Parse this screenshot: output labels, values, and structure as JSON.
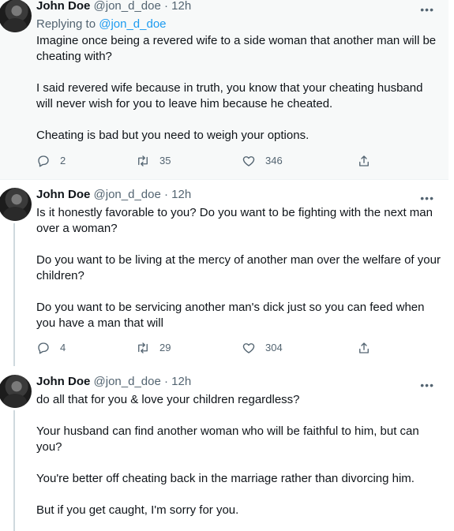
{
  "tweets": [
    {
      "name": "John Doe",
      "handle": "@jon_d_doe",
      "time": "· 12h",
      "reply_prefix": "Replying to ",
      "reply_handle": "@jon_d_doe",
      "paragraphs": [
        "Imagine once being a revered wife to a side woman that another man will be cheating with?",
        "I said revered wife because in truth, you know that your cheating husband will never wish for you to leave him because he cheated.",
        "Cheating is bad but you need to weigh your options."
      ],
      "replies": "2",
      "retweets": "35",
      "likes": "346"
    },
    {
      "name": "John Doe",
      "handle": "@jon_d_doe",
      "time": "· 12h",
      "paragraphs": [
        "Is it honestly favorable to you? Do you want to be fighting with the next man over a woman?",
        "Do you want to be living at the mercy of another man over the welfare of your children?",
        "Do you want to be servicing another man's dick just so you can feed when you have a man that will"
      ],
      "replies": "4",
      "retweets": "29",
      "likes": "304"
    },
    {
      "name": "John Doe",
      "handle": "@jon_d_doe",
      "time": "· 12h",
      "paragraphs": [
        "do all that for you & love your children regardless?",
        "Your husband can find another woman who will be faithful to him, but can you?",
        "You're better off cheating back in the marriage rather than divorcing him.",
        "But if you get caught, I'm sorry for you."
      ]
    }
  ],
  "more_label": "•••",
  "icons": {
    "reply": "reply-icon",
    "retweet": "retweet-icon",
    "like": "like-icon",
    "share": "share-icon",
    "more": "more-icon"
  },
  "colors": {
    "link": "#1d9bf0",
    "secondary_text": "#536471",
    "highlight_bg": "#f7f9f9"
  }
}
